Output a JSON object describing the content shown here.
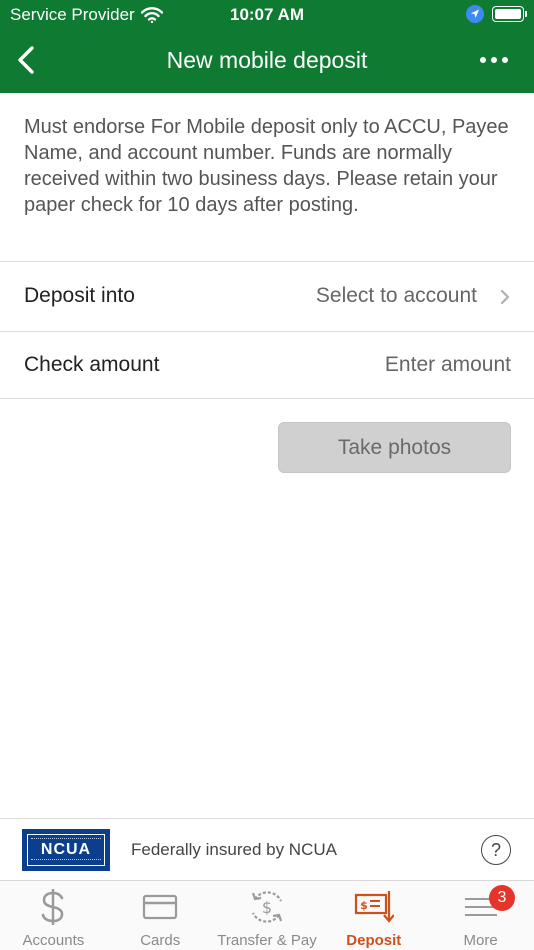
{
  "status_bar": {
    "carrier": "Service Provider",
    "time": "10:07 AM"
  },
  "nav": {
    "title": "New mobile deposit",
    "back_icon": "chevron-left-icon",
    "more_icon": "ellipsis-icon"
  },
  "instructions": "Must endorse For Mobile deposit only to ACCU, Payee Name, and account number. Funds are normally received within two business days. Please retain your paper check for 10 days after posting.",
  "form": {
    "deposit_into_label": "Deposit into",
    "deposit_into_value": "Select to account",
    "check_amount_label": "Check amount",
    "check_amount_placeholder": "Enter amount"
  },
  "take_photos_label": "Take photos",
  "ncua": {
    "logo_text": "NCUA",
    "label": "Federally insured by NCUA",
    "help_glyph": "?"
  },
  "tabs": [
    {
      "label": "Accounts",
      "icon": "dollar-icon"
    },
    {
      "label": "Cards",
      "icon": "card-icon"
    },
    {
      "label": "Transfer & Pay",
      "icon": "transfer-icon"
    },
    {
      "label": "Deposit",
      "icon": "deposit-check-icon",
      "active": true
    },
    {
      "label": "More",
      "icon": "menu-icon"
    }
  ],
  "more_badge": "3",
  "colors": {
    "header_green": "#0e7a32",
    "active_tab": "#d0501c",
    "badge_red": "#e5352b",
    "ncua_blue": "#0b3f8e"
  }
}
